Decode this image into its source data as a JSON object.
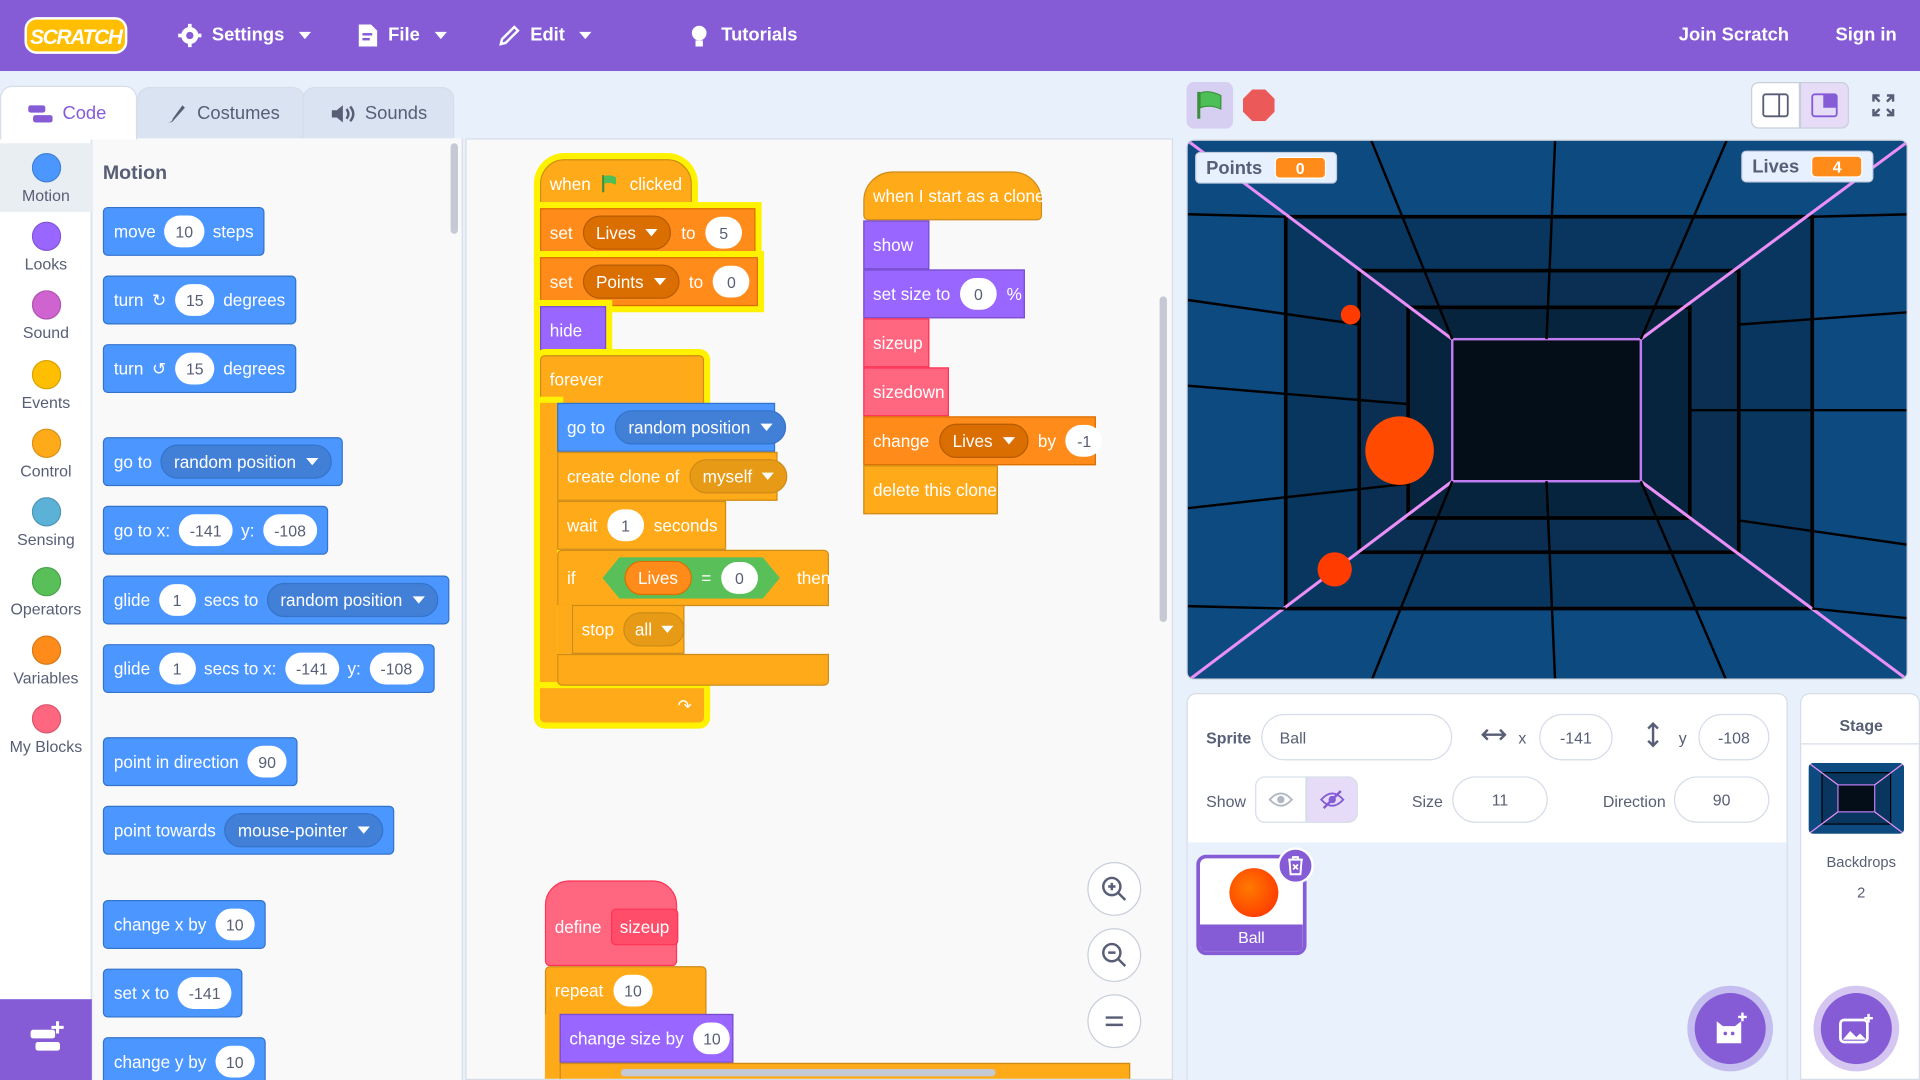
{
  "menubar": {
    "logo": "SCRATCH",
    "settings": "Settings",
    "file": "File",
    "edit": "Edit",
    "tutorials": "Tutorials",
    "join": "Join Scratch",
    "signin": "Sign in"
  },
  "tabs": {
    "code": "Code",
    "costumes": "Costumes",
    "sounds": "Sounds"
  },
  "categories": [
    {
      "label": "Motion",
      "color": "#4c97ff"
    },
    {
      "label": "Looks",
      "color": "#9966ff"
    },
    {
      "label": "Sound",
      "color": "#cf63cf"
    },
    {
      "label": "Events",
      "color": "#ffbf00"
    },
    {
      "label": "Control",
      "color": "#ffab19"
    },
    {
      "label": "Sensing",
      "color": "#5cb1d6"
    },
    {
      "label": "Operators",
      "color": "#59c059"
    },
    {
      "label": "Variables",
      "color": "#ff8c1a"
    },
    {
      "label": "My Blocks",
      "color": "#ff6680"
    }
  ],
  "palette": {
    "heading": "Motion",
    "move": {
      "a": "move",
      "v": "10",
      "b": "steps"
    },
    "turn_right": {
      "a": "turn",
      "v": "15",
      "b": "degrees"
    },
    "turn_left": {
      "a": "turn",
      "v": "15",
      "b": "degrees"
    },
    "goto": {
      "a": "go to",
      "d": "random position"
    },
    "gotoxy": {
      "a": "go to x:",
      "x": "-141",
      "b": "y:",
      "y": "-108"
    },
    "glide": {
      "a": "glide",
      "v": "1",
      "b": "secs to",
      "d": "random position"
    },
    "glidexy": {
      "a": "glide",
      "v": "1",
      "b": "secs to x:",
      "x": "-141",
      "c": "y:",
      "y": "-108"
    },
    "point": {
      "a": "point in direction",
      "v": "90"
    },
    "towards": {
      "a": "point towards",
      "d": "mouse-pointer"
    },
    "changex": {
      "a": "change x by",
      "v": "10"
    },
    "setx": {
      "a": "set x to",
      "v": "-141"
    },
    "changey": {
      "a": "change y by",
      "v": "10"
    }
  },
  "script1": {
    "hat_a": "when",
    "hat_b": "clicked",
    "set1": {
      "a": "set",
      "var": "Lives",
      "b": "to",
      "v": "5"
    },
    "set2": {
      "a": "set",
      "var": "Points",
      "b": "to",
      "v": "0"
    },
    "hide": "hide",
    "forever": "forever",
    "goto": {
      "a": "go to",
      "d": "random position"
    },
    "clone": {
      "a": "create clone of",
      "d": "myself"
    },
    "wait": {
      "a": "wait",
      "v": "1",
      "b": "seconds"
    },
    "if": {
      "a": "if",
      "var": "Lives",
      "op": "=",
      "v": "0",
      "b": "then"
    },
    "stop": {
      "a": "stop",
      "d": "all"
    }
  },
  "script2": {
    "hat": "when I start as a clone",
    "show": "show",
    "setsize": {
      "a": "set size to",
      "v": "0",
      "b": "%"
    },
    "sizeup": "sizeup",
    "sizedown": "sizedown",
    "change": {
      "a": "change",
      "var": "Lives",
      "b": "by",
      "v": "-1"
    },
    "delete": "delete this clone"
  },
  "script3": {
    "define": "define",
    "name": "sizeup",
    "repeat": {
      "a": "repeat",
      "v": "10"
    },
    "changesize": {
      "a": "change size by",
      "v": "10"
    }
  },
  "stage": {
    "points_label": "Points",
    "points_value": "0",
    "lives_label": "Lives",
    "lives_value": "4"
  },
  "sprite": {
    "sprite_label": "Sprite",
    "name": "Ball",
    "x_label": "x",
    "x": "-141",
    "y_label": "y",
    "y": "-108",
    "show_label": "Show",
    "size_label": "Size",
    "size": "11",
    "direction_label": "Direction",
    "direction": "90",
    "thumb_name": "Ball"
  },
  "stage_panel": {
    "title": "Stage",
    "backdrops_label": "Backdrops",
    "backdrops_count": "2"
  },
  "colors": {
    "accent": "#855cd6",
    "motion": "#4c97ff",
    "events": "#ffab19",
    "variables": "#ff8c1a",
    "looks": "#9966ff",
    "myblocks": "#ff6680",
    "operators": "#59c059"
  }
}
